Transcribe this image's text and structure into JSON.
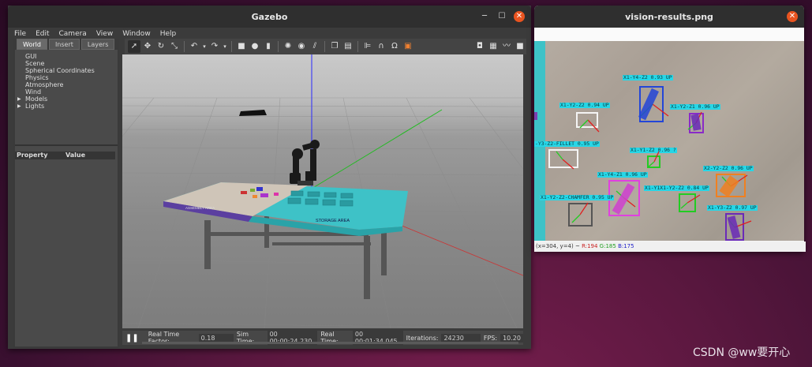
{
  "gazebo": {
    "title": "Gazebo",
    "menu": [
      "File",
      "Edit",
      "Camera",
      "View",
      "Window",
      "Help"
    ],
    "tabs": [
      "World",
      "Insert",
      "Layers"
    ],
    "tree": {
      "items": [
        "GUI",
        "Scene",
        "Spherical Coordinates",
        "Physics",
        "Atmosphere",
        "Wind"
      ],
      "expandable": [
        "Models",
        "Lights"
      ]
    },
    "properties": {
      "col1": "Property",
      "col2": "Value"
    },
    "status": {
      "rtf_label": "Real Time Factor:",
      "rtf_value": "0.18",
      "sim_label": "Sim Time:",
      "sim_value": "00 00:00:24.230",
      "real_label": "Real Time:",
      "real_value": "00 00:01:34.045",
      "iter_label": "Iterations:",
      "iter_value": "24230",
      "fps_label": "FPS:",
      "fps_value": "10.20"
    },
    "scene_text": {
      "table_left": "ASSEMBLY AREA",
      "table_right": "STORAGE AREA"
    }
  },
  "vision": {
    "title": "vision-results.png",
    "status_coords": "(x=304, y=4) ~ ",
    "status_r": "R:194",
    "status_g": "G:185",
    "status_b": "B:175",
    "status_r_color": "#c81e1e",
    "status_g_color": "#1e9e1e",
    "status_b_color": "#1e1ec8",
    "labels": [
      "X1-Y4-Z2 0.93 UP",
      "X1-Y2-Z2 0.94 UP",
      "X1-Y2-Z1 0.96 UP",
      "-Y3-Z2-FILLET 0.95 UP",
      "X1-Y1-Z2 0.96 ?",
      "X2-Y2-Z2 0.96 UP",
      "X1-Y4-Z1 0.96 UP",
      "X1-Y2-Z2-CHAMFER 0.95 UP",
      "X1-Y1X1-Y2-Z2 0.84 UP",
      "X1-Y3-Z2 0.97 UP"
    ]
  },
  "watermark": "CSDN @ww要开心"
}
